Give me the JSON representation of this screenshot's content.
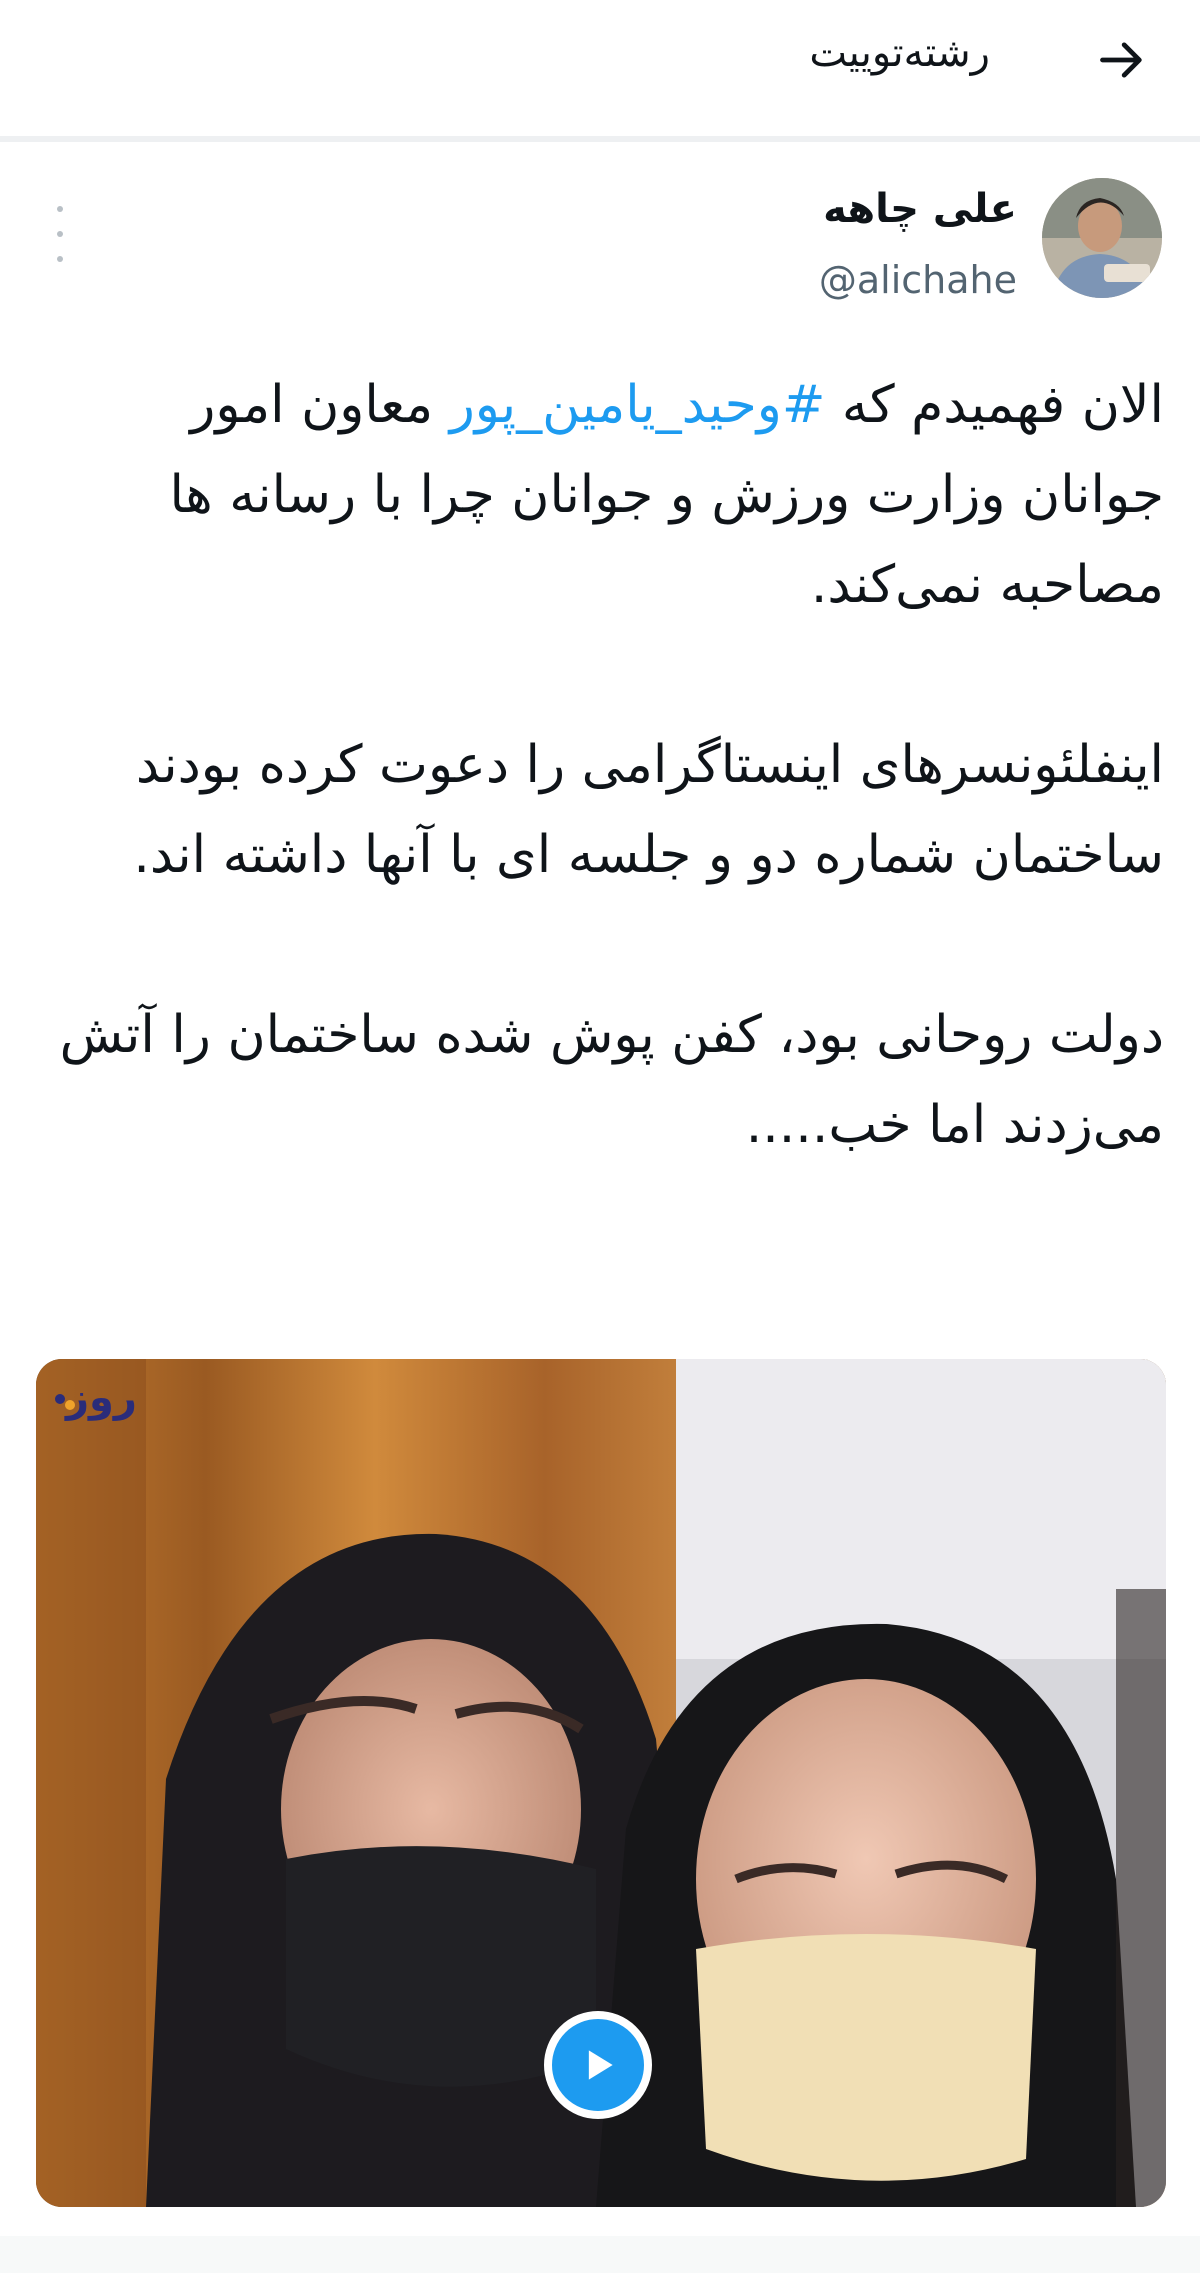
{
  "header": {
    "title": "رشته‌توییت",
    "back_icon": "arrow-right-icon"
  },
  "tweet": {
    "author": {
      "display_name": "علی چاهه",
      "handle": "@alichahe"
    },
    "more_icon": "more-vertical-icon",
    "text": {
      "p1_before": "الان فهمیدم که ",
      "p1_hashtag": "#وحید_یامین_پور",
      "p1_after": " معاون امور جوانان وزارت ورزش و جوانان چرا با رسانه ها مصاحبه نمی‌کند.",
      "p2": "اینفلئونسرهای اینستاگرامی را دعوت کرده بودند ساختمان شماره دو و جلسه ای با آنها داشته اند.",
      "p3": "دولت روحانی بود، کفن پوش شده ساختمان را آتش می‌زدند اما خب....."
    },
    "media": {
      "type": "video",
      "watermark": "روز",
      "play_icon": "play-icon"
    }
  },
  "colors": {
    "accent": "#1d9bf0",
    "text_primary": "#0f1419",
    "text_secondary": "#536471"
  }
}
